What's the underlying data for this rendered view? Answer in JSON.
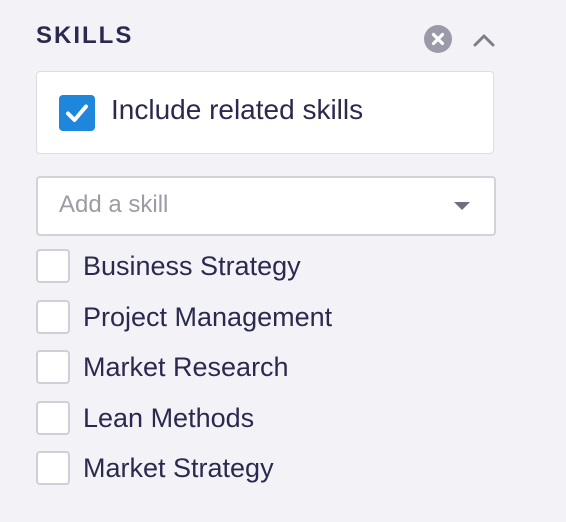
{
  "filter": {
    "title": "SKILLS",
    "clear_icon": "close-circle-icon",
    "collapse_icon": "chevron-up-icon"
  },
  "related": {
    "label": "Include related skills",
    "checked": true,
    "check_color": "#1f87db"
  },
  "add_skill": {
    "placeholder": "Add a skill",
    "caret_icon": "caret-down-icon"
  },
  "skills": [
    {
      "label": "Business Strategy",
      "checked": false
    },
    {
      "label": "Project Management",
      "checked": false
    },
    {
      "label": "Market Research",
      "checked": false
    },
    {
      "label": "Lean Methods",
      "checked": false
    },
    {
      "label": "Market Strategy",
      "checked": false
    }
  ],
  "colors": {
    "background": "#f3f3f7",
    "text": "#2b2a4e",
    "accent": "#1f87db",
    "muted": "#9a9aa8"
  }
}
